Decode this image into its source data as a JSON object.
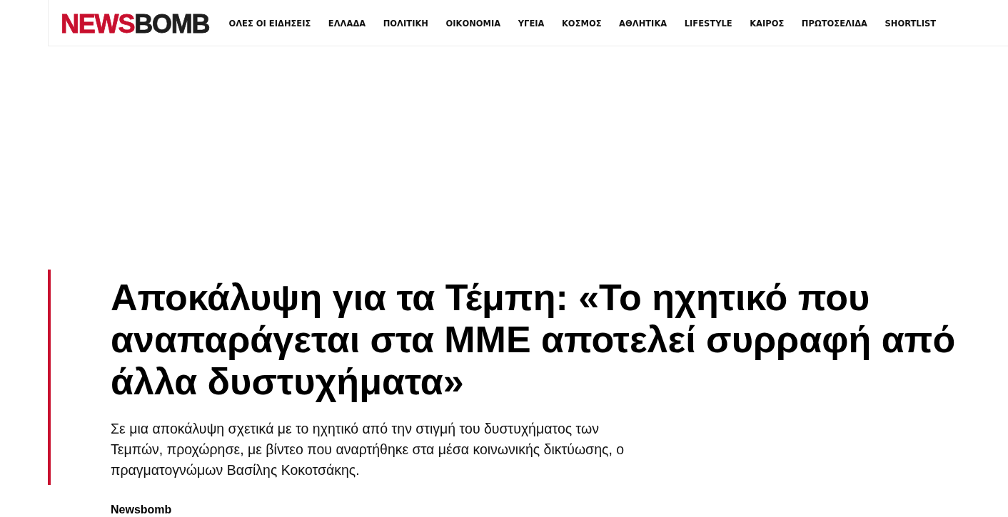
{
  "header": {
    "logo": {
      "part_1": "NEWS",
      "part_2": "BOMB"
    },
    "nav": [
      "ΟΛΕΣ ΟΙ ΕΙΔΗΣΕΙΣ",
      "ΕΛΛΑΔΑ",
      "ΠΟΛΙΤΙΚΗ",
      "ΟΙΚΟΝΟΜΙΑ",
      "ΥΓΕΙΑ",
      "ΚΟΣΜΟΣ",
      "ΑΘΛΗΤΙΚΑ",
      "LIFESTYLE",
      "ΚΑΙΡΟΣ",
      "ΠΡΩΤΟΣΕΛΙΔΑ",
      "SHORTLIST"
    ]
  },
  "article": {
    "title": "Αποκάλυψη για τα Τέμπη: «Το ηχητικό που αναπαράγεται στα ΜΜΕ αποτελεί συρραφή από άλλα δυστυχήματα»",
    "lead": "Σε μια αποκάλυψη σχετικά με το ηχητικό από την στιγμή του δυστυχήματος των Τεμπών, προχώρησε, με βίντεο που αναρτήθηκε στα μέσα κοινωνικής δικτύωσης, ο πραγματογνώμων Βασίλης Κοκοτσάκης.",
    "author": "Newsbomb"
  }
}
